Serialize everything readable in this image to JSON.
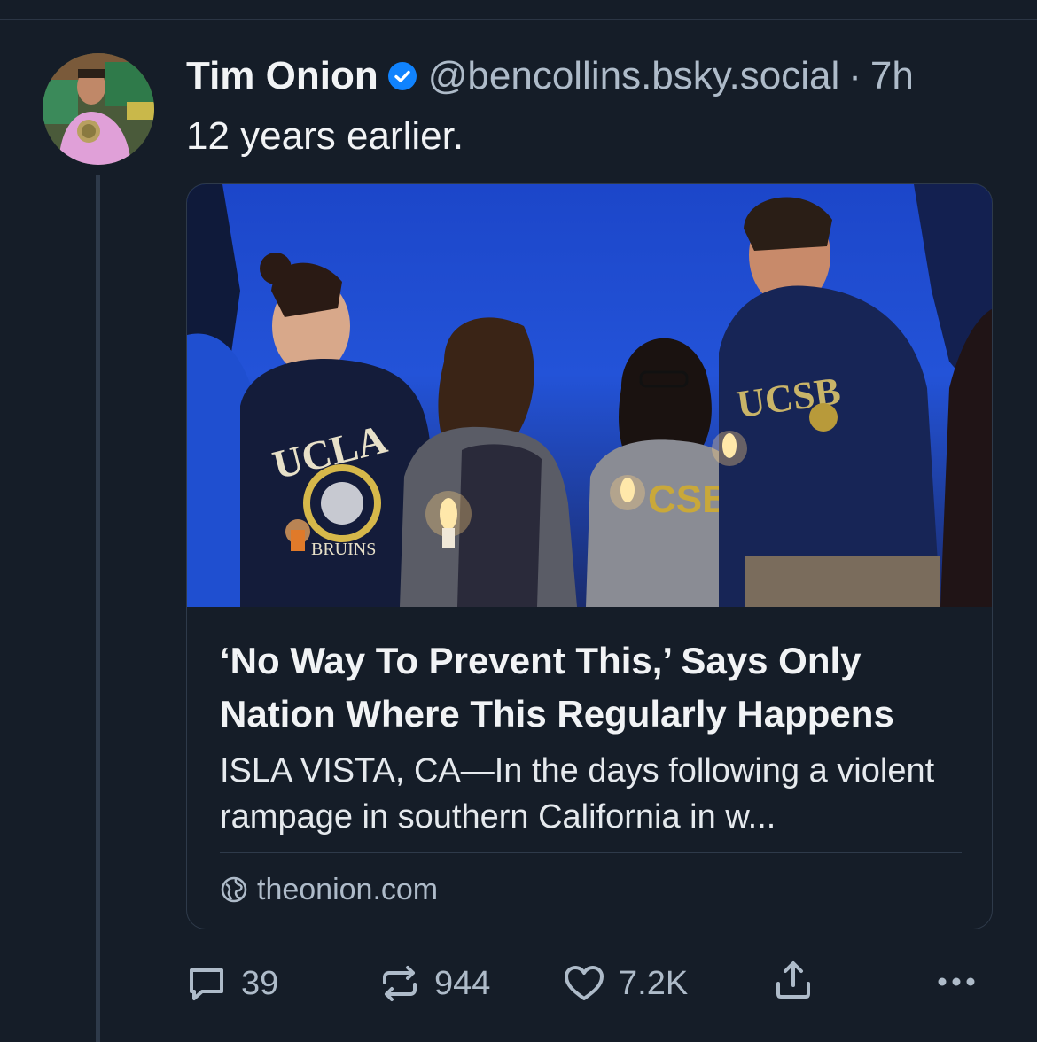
{
  "post": {
    "display_name": "Tim Onion",
    "verified_icon": "verified-check-icon",
    "handle": "@bencollins.bsky.social",
    "separator": "·",
    "time": "7h",
    "text": "12 years earlier."
  },
  "link_card": {
    "image_alt_icon": "vigil-photo",
    "title": "‘No Way To Prevent This,’ Says Only Nation Where This Regularly Happens",
    "description": "ISLA VISTA, CA—In the days following a violent rampage in southern California in w...",
    "domain": "theonion.com",
    "domain_icon": "globe-icon"
  },
  "actions": {
    "reply_count": "39",
    "repost_count": "944",
    "like_count": "7.2K",
    "reply_icon": "reply-icon",
    "repost_icon": "repost-icon",
    "like_icon": "heart-icon",
    "share_icon": "share-icon",
    "more_icon": "more-icon"
  },
  "colors": {
    "background": "#151d28",
    "text_primary": "#f1f3f5",
    "text_secondary": "#aebbc9",
    "border": "#2e3a4a",
    "verified": "#1083fe"
  }
}
